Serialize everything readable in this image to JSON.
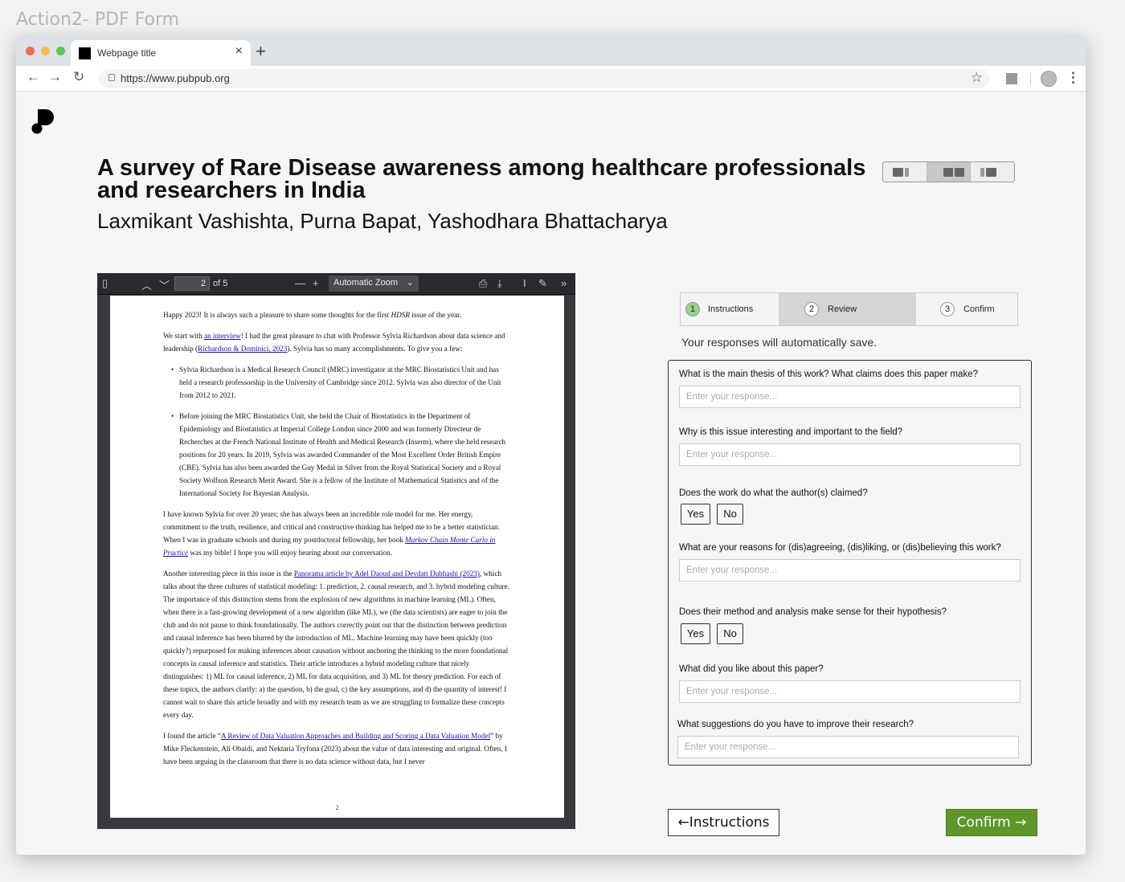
{
  "frame_title": "Action2- PDF Form",
  "browser": {
    "tab_title": "Webpage title",
    "tab_close": "×",
    "new_tab": "+",
    "url": "https://www.pubpub.org",
    "icons": {
      "back": "←",
      "forward": "→",
      "reload": "↻",
      "star": "☆",
      "menu": "⋮"
    },
    "traffic_lights": [
      "#ec6a5e",
      "#f4bf4f",
      "#61c554"
    ]
  },
  "article": {
    "title": "A survey of Rare Disease awareness among healthcare professionals and researchers in India",
    "authors": "Laxmikant Vashishta, Purna Bapat, Yashodhara Bhattacharya"
  },
  "pdf_viewer": {
    "page_current": "2",
    "page_total": "of 5",
    "zoom": "Automatic Zoom",
    "icons": {
      "sidebar": "▯",
      "up": "︿",
      "down": "﹀",
      "zoom_out": "—",
      "zoom_in": "+",
      "chevron": "⌄",
      "print": "⎙",
      "download": "⤓",
      "text_select": "I",
      "draw": "✎",
      "more": "»"
    },
    "page_number": "2",
    "content": {
      "p1_a": "Happy 2023! It is always such a pleasure to share some thoughts for the first ",
      "p1_em": "HDSR",
      "p1_b": " issue of the year.",
      "p2_a": "We start with ",
      "p2_link1": "an interview",
      "p2_b": "! I had the great pleasure to chat with Professor Sylvia Richardson about data science and leadership (",
      "p2_link2": "Richardson & Dominici, 2023",
      "p2_c": "). Sylvia has so many accomplishments. To give you a few:",
      "b1": "Sylvia Richardson is a Medical Research Council (MRC) investigator at the MRC Biostatistics Unit and has held a research professorship in the University of Cambridge since 2012. Sylvia was also director of the Unit from 2012 to 2021.",
      "b2": "Before joining the MRC Biostatistics Unit, she held the Chair of Biostatistics in the Department of Epidemiology and Biostatistics at Imperial College London since 2000 and was formerly Directeur de Recherches at the French National Institute of Health and Medical Research (Inserm), where she held research positions for 20 years. In 2019, Sylvia was awarded Commander of the Most Excellent Order British Empire (CBE). Sylvia has also been awarded the Guy Medal in Silver from the Royal Statistical Society and a Royal Society Wolfson Research Merit Award. She is a fellow of the Institute of Mathematical Statistics and of the International Society for Bayesian Analysis.",
      "p3_a": "I have known Sylvia for over 20 years; she has always been an incredible role model for me. Her energy, commitment to the truth, resilience, and critical and constructive thinking has helped me to be a better statistician. When I was in graduate schools and during my postdoctoral fellowship, her book ",
      "p3_link": "Markov Chain Monte Carlo in Practice",
      "p3_b": " was my bible! I hope you will enjoy hearing about our conversation.",
      "p4_a": "Another interesting piece in this issue is the ",
      "p4_link": "Panorama article by Adel Daoud and Devdatt Dubhashi (2023)",
      "p4_b": ", which talks about the three cultures of statistical modeling: 1. prediction, 2. causal research, and 3. hybrid modeling culture. The importance of this distinction stems from the explosion of new algorithms in machine learning (ML). Often, when there is a fast-growing development of a new algorithm (like ML), we (the data scientists) are eager to join the club and do not pause to think foundationally. The authors correctly point out that the distinction between prediction and causal inference has been blurred by the introduction of ML. Machine learning may have been quickly (too quickly?) repurposed for making inferences about causation without anchoring the thinking to the more foundational concepts in causal inference and statistics. Their article introduces a hybrid modeling culture that nicely distinguishes: 1) ML for causal inference, 2) ML for data acquisition, and 3) ML for theory prediction. For each of these topics, the authors clarify: a) the question, b) the goal, c) the key assumptions, and d) the quantity of interest! I cannot wait to share this article broadly and with my research team as we are struggling to formalize these concepts every day.",
      "p5_a": "I found the article “",
      "p5_link": "A Review of Data Valuation Approaches and Building and Scoring a Data Valuation Model",
      "p5_b": "” by Mike Fleckenstein, Ali Obaidi, and Nektaria Tryfona (2023) about the value of data interesting and original. Often, I have been arguing in the classroom that there is no data science without data, but I never"
    }
  },
  "review": {
    "steps": [
      {
        "num": "1",
        "label": "Instructions"
      },
      {
        "num": "2",
        "label": "Review"
      },
      {
        "num": "3",
        "label": "Confirm"
      }
    ],
    "autosave": "Your responses will automatically save.",
    "placeholder": "Enter your response...",
    "yes": "Yes",
    "no": "No",
    "questions": {
      "q1": "What is the main thesis of this work? What claims does this paper make?",
      "q2": "Why is this issue interesting and important to the field?",
      "q3": "Does the work do what the author(s) claimed?",
      "q4": "What are your reasons for (dis)agreeing, (dis)liking, or (dis)believing this work?",
      "q5": "Does their method and analysis make sense for their hypothesis?",
      "q6": "What did you like about this paper?",
      "q7": "What suggestions do you have to improve their research?"
    },
    "back_button": "←Instructions",
    "confirm_button": "Confirm →",
    "accent": "#5e962a"
  }
}
